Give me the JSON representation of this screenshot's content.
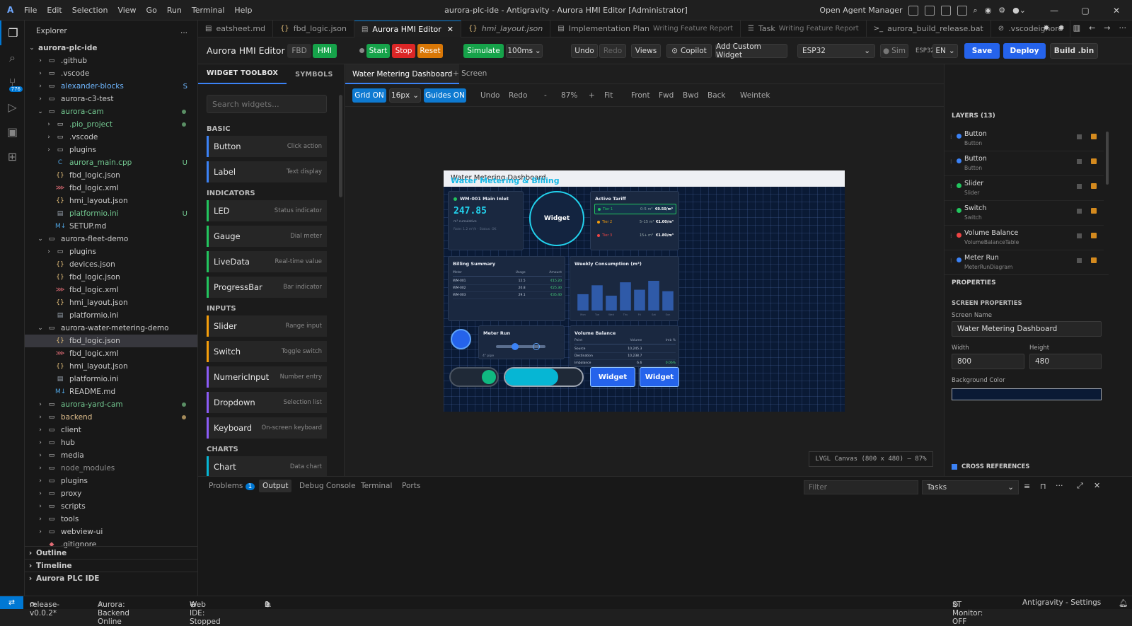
{
  "menu": [
    "File",
    "Edit",
    "Selection",
    "View",
    "Go",
    "Run",
    "Terminal",
    "Help"
  ],
  "window_title": "aurora-plc-ide - Antigravity - Aurora HMI Editor [Administrator]",
  "open_agent_manager": "Open Agent Manager",
  "activity": {
    "badge": "776"
  },
  "explorer": {
    "title": "Explorer",
    "more": "...",
    "root": "aurora-plc-ide",
    "rows": [
      {
        "label": ".github",
        "depth": 1,
        "chev": "›",
        "icon": "folder",
        "color": "#cccccc",
        "status": ""
      },
      {
        "label": ".vscode",
        "depth": 1,
        "chev": "›",
        "icon": "folder",
        "color": "#cccccc",
        "status": ""
      },
      {
        "label": "alexander-blocks",
        "depth": 1,
        "chev": "›",
        "icon": "folder",
        "color": "#6fb7ff",
        "status": "S"
      },
      {
        "label": "aurora-c3-test",
        "depth": 1,
        "chev": "›",
        "icon": "folder",
        "color": "#cccccc",
        "status": ""
      },
      {
        "label": "aurora-cam",
        "depth": 1,
        "chev": "⌄",
        "icon": "folder",
        "color": "#73c991",
        "status": "dot"
      },
      {
        "label": ".pio_project",
        "depth": 2,
        "chev": "›",
        "icon": "folder",
        "color": "#73c991",
        "status": "dot"
      },
      {
        "label": ".vscode",
        "depth": 2,
        "chev": "›",
        "icon": "folder",
        "color": "#cccccc",
        "status": ""
      },
      {
        "label": "plugins",
        "depth": 2,
        "chev": "›",
        "icon": "folder",
        "color": "#cccccc",
        "status": ""
      },
      {
        "label": "aurora_main.cpp",
        "depth": 2,
        "chev": "",
        "icon": "cpp",
        "color": "#73c991",
        "status": "U"
      },
      {
        "label": "fbd_logic.json",
        "depth": 2,
        "chev": "",
        "icon": "json",
        "color": "#cccccc",
        "status": ""
      },
      {
        "label": "fbd_logic.xml",
        "depth": 2,
        "chev": "",
        "icon": "xml",
        "color": "#cccccc",
        "status": ""
      },
      {
        "label": "hmi_layout.json",
        "depth": 2,
        "chev": "",
        "icon": "json",
        "color": "#cccccc",
        "status": ""
      },
      {
        "label": "platformio.ini",
        "depth": 2,
        "chev": "",
        "icon": "ini",
        "color": "#73c991",
        "status": "U"
      },
      {
        "label": "SETUP.md",
        "depth": 2,
        "chev": "",
        "icon": "md",
        "color": "#cccccc",
        "status": ""
      },
      {
        "label": "aurora-fleet-demo",
        "depth": 1,
        "chev": "⌄",
        "icon": "folder",
        "color": "#cccccc",
        "status": ""
      },
      {
        "label": "plugins",
        "depth": 2,
        "chev": "›",
        "icon": "folder",
        "color": "#cccccc",
        "status": ""
      },
      {
        "label": "devices.json",
        "depth": 2,
        "chev": "",
        "icon": "json",
        "color": "#cccccc",
        "status": ""
      },
      {
        "label": "fbd_logic.json",
        "depth": 2,
        "chev": "",
        "icon": "json",
        "color": "#cccccc",
        "status": ""
      },
      {
        "label": "fbd_logic.xml",
        "depth": 2,
        "chev": "",
        "icon": "xml",
        "color": "#cccccc",
        "status": ""
      },
      {
        "label": "hmi_layout.json",
        "depth": 2,
        "chev": "",
        "icon": "json",
        "color": "#cccccc",
        "status": ""
      },
      {
        "label": "platformio.ini",
        "depth": 2,
        "chev": "",
        "icon": "ini",
        "color": "#cccccc",
        "status": ""
      },
      {
        "label": "aurora-water-metering-demo",
        "depth": 1,
        "chev": "⌄",
        "icon": "folder",
        "color": "#cccccc",
        "status": ""
      },
      {
        "label": "fbd_logic.json",
        "depth": 2,
        "chev": "",
        "icon": "json",
        "color": "#cccccc",
        "status": "",
        "selected": true
      },
      {
        "label": "fbd_logic.xml",
        "depth": 2,
        "chev": "",
        "icon": "xml",
        "color": "#cccccc",
        "status": ""
      },
      {
        "label": "hmi_layout.json",
        "depth": 2,
        "chev": "",
        "icon": "json",
        "color": "#cccccc",
        "status": ""
      },
      {
        "label": "platformio.ini",
        "depth": 2,
        "chev": "",
        "icon": "ini",
        "color": "#cccccc",
        "status": ""
      },
      {
        "label": "README.md",
        "depth": 2,
        "chev": "",
        "icon": "md",
        "color": "#cccccc",
        "status": ""
      },
      {
        "label": "aurora-yard-cam",
        "depth": 1,
        "chev": "›",
        "icon": "folder",
        "color": "#73c991",
        "status": "dot"
      },
      {
        "label": "backend",
        "depth": 1,
        "chev": "›",
        "icon": "folder",
        "color": "#e2c08d",
        "status": "dotb"
      },
      {
        "label": "client",
        "depth": 1,
        "chev": "›",
        "icon": "folder",
        "color": "#cccccc",
        "status": ""
      },
      {
        "label": "hub",
        "depth": 1,
        "chev": "›",
        "icon": "folder",
        "color": "#cccccc",
        "status": ""
      },
      {
        "label": "media",
        "depth": 1,
        "chev": "›",
        "icon": "folder",
        "color": "#cccccc",
        "status": ""
      },
      {
        "label": "node_modules",
        "depth": 1,
        "chev": "›",
        "icon": "folder",
        "color": "#8c8c8c",
        "status": ""
      },
      {
        "label": "plugins",
        "depth": 1,
        "chev": "›",
        "icon": "folder",
        "color": "#cccccc",
        "status": ""
      },
      {
        "label": "proxy",
        "depth": 1,
        "chev": "›",
        "icon": "folder",
        "color": "#cccccc",
        "status": ""
      },
      {
        "label": "scripts",
        "depth": 1,
        "chev": "›",
        "icon": "folder",
        "color": "#cccccc",
        "status": ""
      },
      {
        "label": "tools",
        "depth": 1,
        "chev": "›",
        "icon": "folder",
        "color": "#cccccc",
        "status": ""
      },
      {
        "label": "webview-ui",
        "depth": 1,
        "chev": "›",
        "icon": "folder",
        "color": "#cccccc",
        "status": ""
      },
      {
        "label": ".gitignore",
        "depth": 1,
        "chev": "",
        "icon": "git",
        "color": "#cccccc",
        "status": ""
      }
    ],
    "sections": [
      "Outline",
      "Timeline",
      "Aurora PLC IDE"
    ]
  },
  "tabs": [
    {
      "label": "eatsheet.md",
      "sub": "",
      "icon": "md"
    },
    {
      "label": "fbd_logic.json",
      "sub": "",
      "icon": "{}"
    },
    {
      "label": "Aurora HMI Editor",
      "sub": "",
      "icon": "doc",
      "active": true
    },
    {
      "label": "hmi_layout.json",
      "sub": "",
      "icon": "{}"
    },
    {
      "label": "Implementation Plan",
      "sub": "Writing Feature Report",
      "icon": "doc"
    },
    {
      "label": "Task",
      "sub": "Writing Feature Report",
      "icon": "list"
    },
    {
      "label": "aurora_build_release.bat",
      "sub": "",
      "icon": ">_"
    },
    {
      "label": ".vscodeignore",
      "sub": "",
      "icon": "⊘"
    }
  ],
  "toolbar": {
    "title": "Aurora HMI Editor",
    "fbd": "FBD",
    "hmi": "HMI",
    "start": "Start",
    "stop": "Stop",
    "reset": "Reset",
    "simulate": "Simulate",
    "interval": "100ms",
    "undo": "Undo",
    "redo": "Redo",
    "views": "Views",
    "copilot": "Copilot",
    "add_custom": "Add Custom Widget",
    "target": "ESP32",
    "sim": "Sim",
    "esp32": "ESP32",
    "lang": "EN",
    "save": "Save",
    "deploy": "Deploy",
    "build": "Build .bin"
  },
  "toolbox": {
    "tab1": "WIDGET TOOLBOX",
    "tab2": "SYMBOLS",
    "search_placeholder": "Search widgets...",
    "categories": [
      {
        "name": "BASIC",
        "items": [
          {
            "name": "Button",
            "desc": "Click action",
            "color": "#3b82f6"
          },
          {
            "name": "Label",
            "desc": "Text display",
            "color": "#3b82f6"
          }
        ]
      },
      {
        "name": "INDICATORS",
        "items": [
          {
            "name": "LED",
            "desc": "Status indicator",
            "color": "#22c55e"
          },
          {
            "name": "Gauge",
            "desc": "Dial meter",
            "color": "#22c55e"
          },
          {
            "name": "LiveData",
            "desc": "Real-time value",
            "color": "#22c55e"
          },
          {
            "name": "ProgressBar",
            "desc": "Bar indicator",
            "color": "#22c55e"
          }
        ]
      },
      {
        "name": "INPUTS",
        "items": [
          {
            "name": "Slider",
            "desc": "Range input",
            "color": "#f59e0b"
          },
          {
            "name": "Switch",
            "desc": "Toggle switch",
            "color": "#f59e0b"
          },
          {
            "name": "NumericInput",
            "desc": "Number entry",
            "color": "#8b5cf6"
          },
          {
            "name": "Dropdown",
            "desc": "Selection list",
            "color": "#8b5cf6"
          },
          {
            "name": "Keyboard",
            "desc": "On-screen keyboard",
            "color": "#8b5cf6"
          }
        ]
      },
      {
        "name": "CHARTS",
        "items": [
          {
            "name": "Chart",
            "desc": "Data chart",
            "color": "#06b6d4"
          }
        ]
      }
    ]
  },
  "canvas": {
    "screen_tab": "Water Metering Dashboard",
    "add_screen": "+ Screen",
    "grid": "Grid ON",
    "grid_size": "16px",
    "guides": "Guides ON",
    "undo": "Undo",
    "redo": "Redo",
    "minus": "-",
    "zoom": "87%",
    "plus": "+",
    "fit": "Fit",
    "front": "Front",
    "fwd": "Fwd",
    "bwd": "Bwd",
    "back": "Back",
    "weintek": "Weintek",
    "status": "LVGL Canvas (800 x 480) — 87%"
  },
  "hmi": {
    "header": "Water Metering Dashboard",
    "header_overlay": "Water Metering & Billing",
    "meter": {
      "title": "WM-001 Main Inlet",
      "value": "247.85",
      "unit": "m³ cumulative",
      "sub": "Rate: 1.2 m³/h · Status: OK"
    },
    "widget_circle": "Widget",
    "tariff": {
      "title": "Active Tariff",
      "rows": [
        {
          "name": "Tier 1",
          "range": "0–5 m³",
          "price": "€0.50/m³",
          "color": "#22c55e",
          "active": true
        },
        {
          "name": "Tier 2",
          "range": "5–15 m³",
          "price": "€1.00/m³",
          "color": "#f59e0b"
        },
        {
          "name": "Tier 3",
          "range": "15+ m³",
          "price": "€1.80/m³",
          "color": "#ef4444"
        }
      ]
    },
    "billing": {
      "title": "Billing Summary",
      "headers": [
        "Meter",
        "Usage",
        "Amount"
      ],
      "rows": [
        [
          "WM-001",
          "12.5",
          "€15.20"
        ],
        [
          "WM-002",
          "20.8",
          "€25.30"
        ],
        [
          "WM-003",
          "29.1",
          "€35.40"
        ]
      ]
    },
    "weekly": {
      "title": "Weekly Consumption (m³)"
    },
    "meter_run": {
      "title": "Meter Run",
      "pipe": "4\" pipe"
    },
    "volume": {
      "title": "Volume Balance",
      "headers": [
        "Point",
        "Volume",
        "Imb %"
      ],
      "rows": [
        [
          "Source",
          "10,245.3",
          ""
        ],
        [
          "Destination",
          "10,238.7",
          ""
        ],
        [
          "Imbalance",
          "6.6",
          "0.06%"
        ]
      ]
    },
    "btn1": "Widget",
    "btn2": "Widget"
  },
  "chart_data": {
    "type": "bar",
    "title": "Weekly Consumption (m³)",
    "categories": [
      "Mon",
      "Tue",
      "Wed",
      "Thu",
      "Fri",
      "Sat",
      "Sun"
    ],
    "values": [
      0.55,
      0.85,
      0.5,
      0.95,
      0.7,
      1.0,
      0.65
    ]
  },
  "right": {
    "layers_title": "LAYERS (13)",
    "layers": [
      {
        "name": "Button",
        "type": "Button",
        "color": "#3b82f6"
      },
      {
        "name": "Button",
        "type": "Button",
        "color": "#3b82f6"
      },
      {
        "name": "Slider",
        "type": "Slider",
        "color": "#22c55e"
      },
      {
        "name": "Switch",
        "type": "Switch",
        "color": "#22c55e"
      },
      {
        "name": "Volume Balance",
        "type": "VolumeBalanceTable",
        "color": "#ef4444"
      },
      {
        "name": "Meter Run",
        "type": "MeterRunDiagram",
        "color": "#3b82f6"
      }
    ],
    "properties": "PROPERTIES",
    "screen_props": "SCREEN PROPERTIES",
    "screen_name_label": "Screen Name",
    "screen_name": "Water Metering Dashboard",
    "width_label": "Width",
    "width": "800",
    "height_label": "Height",
    "height": "480",
    "bg_label": "Background Color",
    "bg_color": "#0a1a35",
    "cross_refs": "CROSS REFERENCES"
  },
  "bottom": {
    "tabs": [
      "Problems",
      "Output",
      "Debug Console",
      "Terminal",
      "Ports"
    ],
    "problems_count": "1",
    "filter_placeholder": "Filter",
    "tasks": "Tasks"
  },
  "status": {
    "branch": "release-v0.0.2*",
    "backend": "Aurora: Backend Online",
    "webide": "Web IDE: Stopped",
    "errors": "0",
    "warnings": "1",
    "st_monitor": "ST Monitor: OFF",
    "settings": "Antigravity - Settings"
  }
}
